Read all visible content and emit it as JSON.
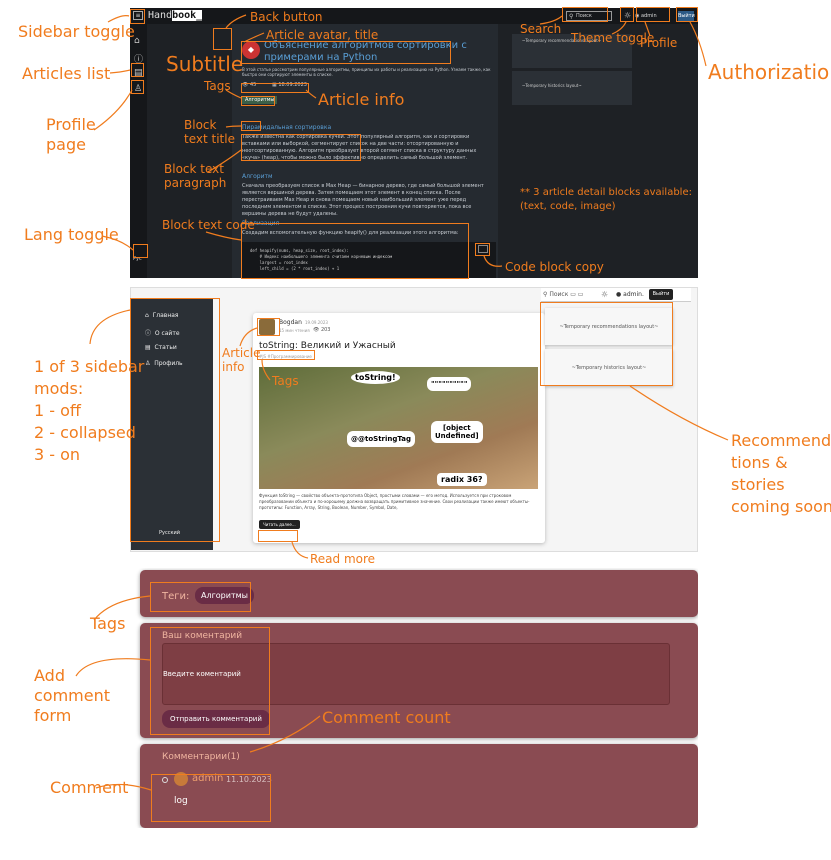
{
  "annotations": {
    "sidebar_toggle": "Sidebar toggle",
    "articles_list": "Articles list",
    "profile_page": "Profile\npage",
    "lang_toggle": "Lang toggle",
    "back_button": "Back button",
    "article_avatar_title": "Article avatar, title",
    "subtitle": "Subtitle",
    "tags": "Tags",
    "article_info": "Article info",
    "block_text_title": "Block\ntext title",
    "block_text_paragraph": "Block text\nparagraph",
    "block_text_code": "Block text code",
    "search": "Search",
    "theme_toggle": "Theme toggle",
    "profile": "Profile",
    "authorization": "Authorization",
    "three_blocks": "** 3 article detail blocks available:\n(text, code, image)",
    "code_block_copy": "Code block copy",
    "sidebar_mods": "1 of 3 sidebar\nmods:\n1 - off\n2 - collapsed\n3 - on",
    "article_info2": "Article\ninfo",
    "tags2": "Tags",
    "read_more": "Read more",
    "recommendations": "Recommenda\ntions &\nstories\ncoming soon!",
    "tags3": "Tags",
    "add_comment_form": "Add\ncomment\nform",
    "comment_count": "Comment count",
    "comment": "Comment"
  },
  "handbook": {
    "logo_a": "Hand",
    "logo_b": "book_",
    "search": "Поиск",
    "user": "admin",
    "logout": "Выйти",
    "lang": "Рус",
    "title": "Объяснение алгоритмов сортировки с примерами на Python",
    "subtitle": "В этой статье рассмотрим популярные алгоритмы, принципы их работы и реализацию на Python. Узнаем также, как быстро они сортируют элементы в списке.",
    "views": "45",
    "date": "18.09.2023",
    "tag": "Алгоритмы",
    "block1_title": "Пирамидальная сортировка",
    "block1_text": "Также известна как сортировка кучей. Этот популярный алгоритм, как и сортировки вставками или выборкой, сегментирует список на две части: отсортированную и неотсортированную. Алгоритм преобразует второй сегмент списка в структуру данных «куча» (heap), чтобы можно было эффективно определить самый большой элемент.",
    "block2_title": "Алгоритм",
    "block2_text": "Сначала преобразуем список в Max Heap — бинарное дерево, где самый большой элемент является вершиной дерева. Затем помещаем этот элемент в конец списка. После перестраиваем Max Heap и снова помещаем новый наибольший элемент уже перед последним элементом в списке. Этот процесс построения кучи повторяется, пока все вершины дерева не будут удалены.",
    "block3_title": "Реализация",
    "block3_text": "Создадим вспомогательную функцию heapify() для реализации этого алгоритма:",
    "code": "def heapify(nums, heap_size, root_index):\n    # Индекс наибольшего элемента считаем корневым индексом\n    largest = root_index\n    left_child = (2 * root_index) + 1",
    "rec_layout": "~Temporary recommendations layout~",
    "hist_layout": "~Temporary historics layout~"
  },
  "light": {
    "search": "Поиск",
    "user": "admin.",
    "logout": "Выйти",
    "menu": [
      "Главная",
      "О сайте",
      "Статьи",
      "Профиль"
    ],
    "lang": "Русский",
    "author": "Bogdan",
    "date": "19.09.2023",
    "read_time": "15 мин чтения",
    "views": "203",
    "title": "toString: Великий и Ужасный",
    "tags": "#JS  #Программирование",
    "meme": [
      "toString!",
      "\"\"\"\"\"\"\"\"\"\"",
      "@@toStringTag",
      "[object\nUndefined]",
      "radix 36?"
    ],
    "excerpt": "Функция toString — свойство объекта-прототипа Object, простыми словами — его метод. Используется при строковом преобразовании объекта и по-хорошему должна возвращать примитивное значение. Свои реализации также имеют объекты-прототипы: Function, Array, String, Boolean, Number, Symbol, Date,",
    "read_more": "Читать далее...",
    "rec_layout": "~Temporary recommendations layout~",
    "hist_layout": "~Temporary historics layout~"
  },
  "comments": {
    "tags_label": "Теги:",
    "tag": "Алгоритмы",
    "your_comment": "Ваш коментарий",
    "placeholder": "Введите коментарий",
    "submit": "Отправить комментарий",
    "count_label": "Комментарии(1)",
    "author": "admin",
    "date": "11.10.2023",
    "text": "log"
  },
  "colors": {
    "accent": "#f07c1e",
    "maroon": "#8a4b52",
    "dark": "#1e2125"
  }
}
